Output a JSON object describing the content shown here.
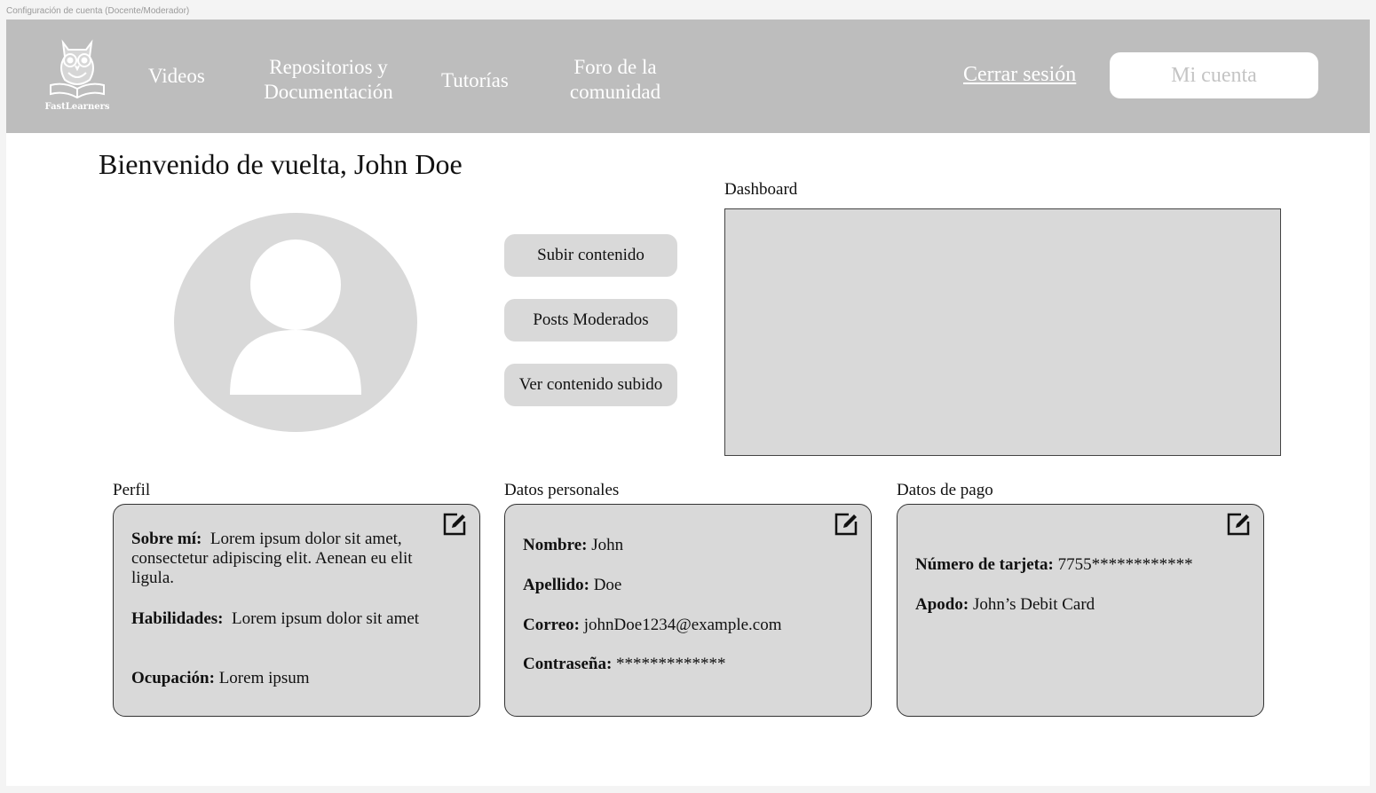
{
  "frame_title": "Configuración de cuenta (Docente/Moderador)",
  "brand": {
    "name": "FastLearners"
  },
  "nav": {
    "videos": "Videos",
    "repos_line1": "Repositorios y",
    "repos_line2": "Documentación",
    "tutorias": "Tutorías",
    "foro_line1": "Foro de la",
    "foro_line2": "comunidad",
    "logout": "Cerrar sesión",
    "account": "Mi cuenta"
  },
  "welcome": "Bienvenido de vuelta, John Doe",
  "actions": {
    "upload": "Subir contenido",
    "moderated": "Posts Moderados",
    "view_uploaded": "Ver contenido subido"
  },
  "dashboard": {
    "label": "Dashboard"
  },
  "perfil": {
    "label": "Perfil",
    "about_key": "Sobre mí:",
    "about_value": "Lorem ipsum dolor sit amet, consectetur adipiscing elit. Aenean eu elit  ligula.",
    "skills_key": "Habilidades:",
    "skills_value": "Lorem ipsum dolor sit amet",
    "occupation_key": "Ocupación:",
    "occupation_value": "Lorem ipsum"
  },
  "personal": {
    "label": "Datos personales",
    "name_key": "Nombre:",
    "name_value": "John",
    "surname_key": "Apellido:",
    "surname_value": "Doe",
    "email_key": "Correo:",
    "email_value": "johnDoe1234@example.com",
    "password_key": "Contraseña:",
    "password_value": "*************"
  },
  "payment": {
    "label": "Datos de pago",
    "card_key": "Número de tarjeta:",
    "card_value": "7755************",
    "alias_key": "Apodo:",
    "alias_value": "John’s Debit Card"
  },
  "colors": {
    "navbar": "#bdbdbd",
    "panel": "#d9d9d9",
    "nav_text": "#ffffff"
  },
  "icons": [
    "owl-logo-icon",
    "user-silhouette-icon",
    "edit-icon"
  ]
}
